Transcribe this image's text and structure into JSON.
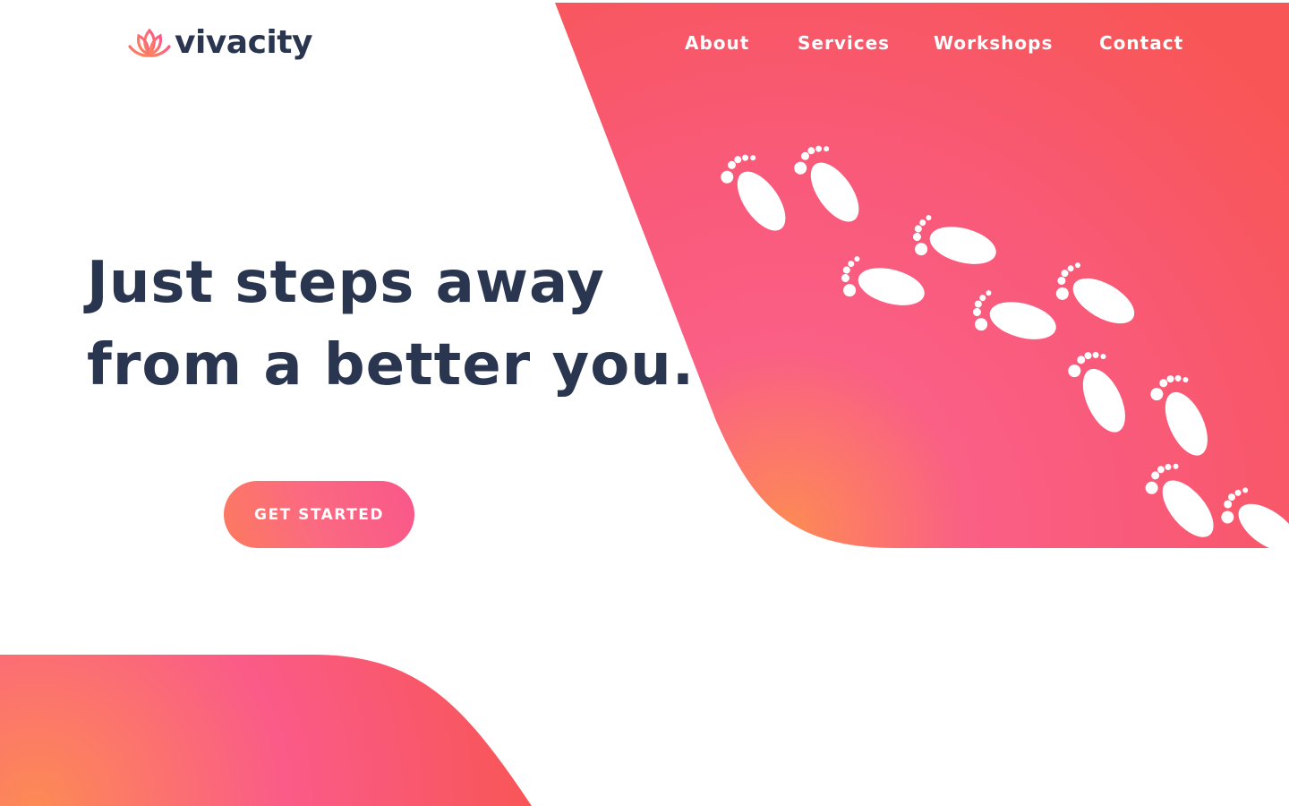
{
  "brand": {
    "name": "vivacity",
    "logo_icon": "lotus-icon"
  },
  "nav": {
    "items": [
      {
        "label": "About"
      },
      {
        "label": "Services"
      },
      {
        "label": "Workshops"
      },
      {
        "label": "Contact"
      }
    ]
  },
  "hero": {
    "headline_line1": "Just steps away",
    "headline_line2": "from a better you.",
    "cta_label": "GET STARTED",
    "decoration_icon": "footprints-icon"
  },
  "colors": {
    "text_dark": "#2a3550",
    "accent_pink": "#f9578b",
    "accent_coral": "#fc7a5f",
    "accent_red": "#f85656",
    "white": "#ffffff"
  }
}
